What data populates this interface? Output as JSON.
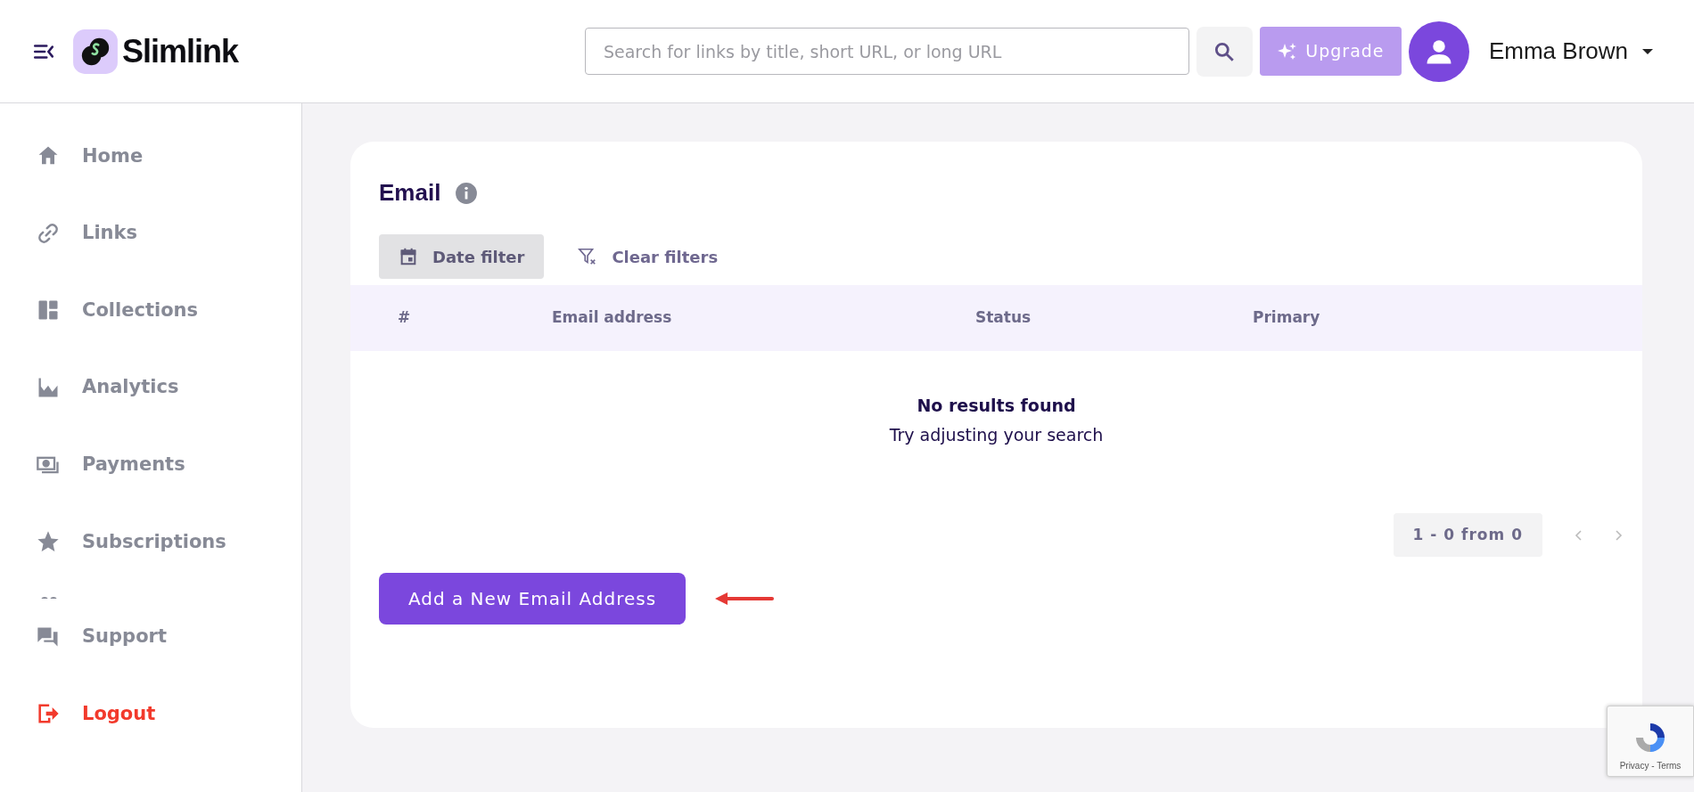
{
  "header": {
    "logo_text": "Slimlink",
    "search": {
      "placeholder": "Search for links by title, short URL, or long URL"
    },
    "upgrade_label": "Upgrade",
    "user_name": "Emma Brown"
  },
  "sidebar": {
    "items": [
      {
        "label": "Home",
        "kind": "home"
      },
      {
        "label": "Links",
        "kind": "links"
      },
      {
        "label": "Collections",
        "kind": "collections"
      },
      {
        "label": "Analytics",
        "kind": "analytics"
      },
      {
        "label": "Payments",
        "kind": "payments"
      },
      {
        "label": "Subscriptions",
        "kind": "subscriptions"
      }
    ],
    "bottom_items": [
      {
        "label": "Support",
        "kind": "support"
      },
      {
        "label": "Logout",
        "kind": "logout"
      }
    ]
  },
  "card": {
    "title": "Email",
    "filters": [
      {
        "label": "Date filter",
        "kind": "date"
      },
      {
        "label": "Clear filters",
        "kind": "clear"
      }
    ],
    "table": {
      "columns": [
        "#",
        "Email address",
        "Status",
        "Primary"
      ],
      "empty_title": "No results found",
      "empty_message": "Try adjusting your search"
    },
    "pagination": {
      "range": "1 - 0 from 0"
    },
    "add_button": "Add a New Email Address"
  },
  "recaptcha": {
    "links": "Privacy - Terms"
  }
}
